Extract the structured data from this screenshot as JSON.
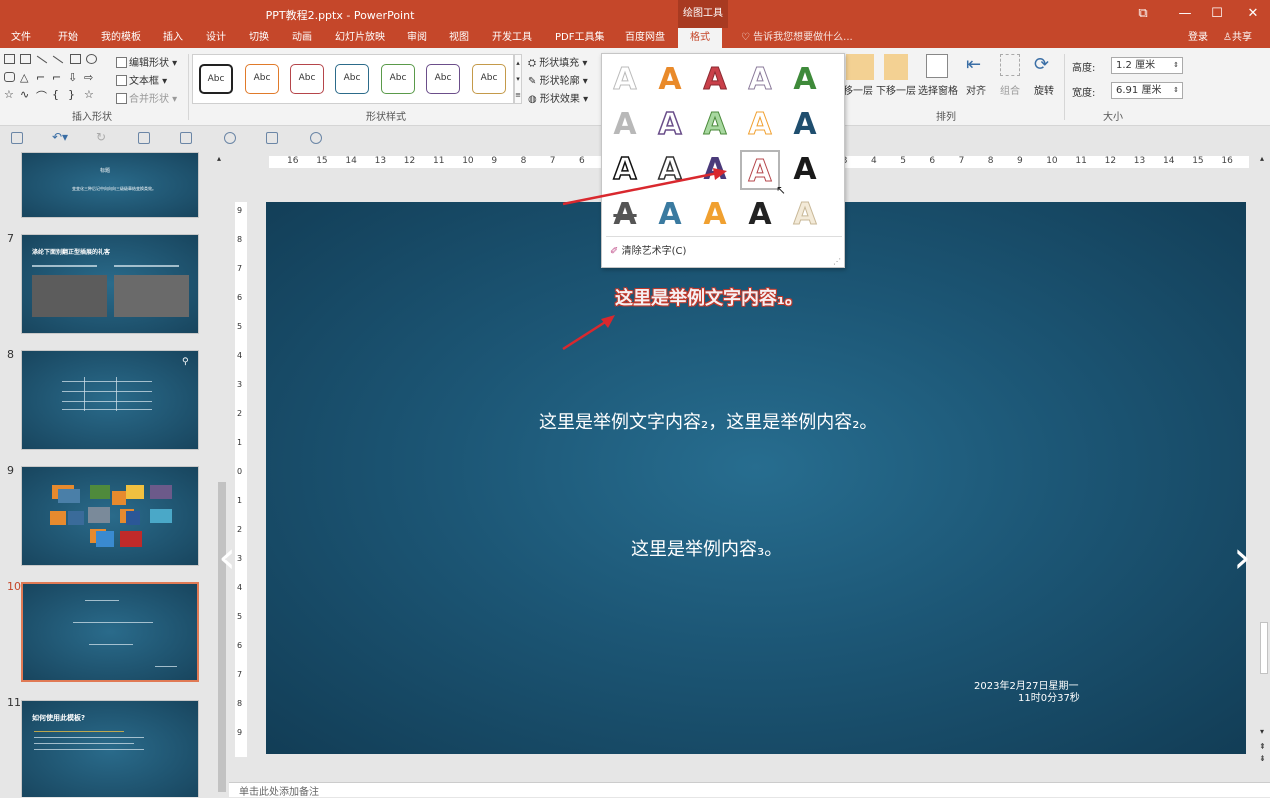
{
  "window": {
    "title": "PPT教程2.pptx - PowerPoint",
    "context_tab": "绘图工具"
  },
  "tabs": [
    "文件",
    "开始",
    "我的模板",
    "插入",
    "设计",
    "切换",
    "动画",
    "幻灯片放映",
    "审阅",
    "视图",
    "开发工具",
    "PDF工具集",
    "百度网盘",
    "格式"
  ],
  "active_tab": "格式",
  "tellme": "告诉我您想要做什么...",
  "account": {
    "login": "登录",
    "share": "共享"
  },
  "ribbon": {
    "insert_shapes": {
      "label": "插入形状",
      "edit_shape": "编辑形状",
      "textbox": "文本框",
      "merge": "合并形状"
    },
    "shape_styles": {
      "label": "形状样式",
      "sample": "Abc",
      "fill": "形状填充",
      "outline": "形状轮廓",
      "effect": "形状效果",
      "colors": [
        "#333333",
        "#e07a2a",
        "#b5454a",
        "#2c6b8a",
        "#5a9a4a",
        "#6b4e8a",
        "#c49a4a"
      ]
    },
    "arrange": {
      "label": "排列",
      "send_back": "下移一层",
      "bring_fwd_partial": "移一层",
      "selection_pane": "选择窗格",
      "align": "对齐",
      "group": "组合",
      "rotate": "旋转"
    },
    "size": {
      "label": "大小",
      "height_label": "高度:",
      "height": "1.2 厘米",
      "width_label": "宽度:",
      "width": "6.91 厘米"
    }
  },
  "wordart_gallery": {
    "clear": "清除艺术字(C)",
    "glyph": "A"
  },
  "thumbnails": [
    {
      "num": "",
      "title": "标题",
      "body": "变变化三种后记中向向向三级级章结变换类效。"
    },
    {
      "num": "7",
      "title": "涤纶下面别翻正型插展的礼客",
      "body": ""
    },
    {
      "num": "8",
      "title": "",
      "body": ""
    },
    {
      "num": "9",
      "title": "",
      "body": ""
    },
    {
      "num": "10",
      "title": "",
      "body": ""
    },
    {
      "num": "11",
      "title": "如何使用此模板?",
      "body": ""
    }
  ],
  "slide": {
    "text1": "这里是举例文字内容₁。",
    "text2": "这里是举例文字内容₂，这里是举例内容₂。",
    "text3": "这里是举例内容₃。",
    "date": "2023年2月27日星期一",
    "time": "11时0分37秒"
  },
  "notes_placeholder": "单击此处添加备注",
  "hruler_labels": [
    "16",
    "15",
    "14",
    "13",
    "12",
    "11",
    "10",
    "9",
    "8",
    "7",
    "6",
    "5",
    "4",
    "3",
    "2",
    "1",
    "0",
    "1",
    "2",
    "3",
    "4",
    "5",
    "6",
    "7",
    "8",
    "9",
    "10",
    "11",
    "12",
    "13",
    "14",
    "15",
    "16"
  ],
  "vruler_labels": [
    "9",
    "8",
    "7",
    "6",
    "5",
    "4",
    "3",
    "2",
    "1",
    "0",
    "1",
    "2",
    "3",
    "4",
    "5",
    "6",
    "7",
    "8",
    "9"
  ]
}
